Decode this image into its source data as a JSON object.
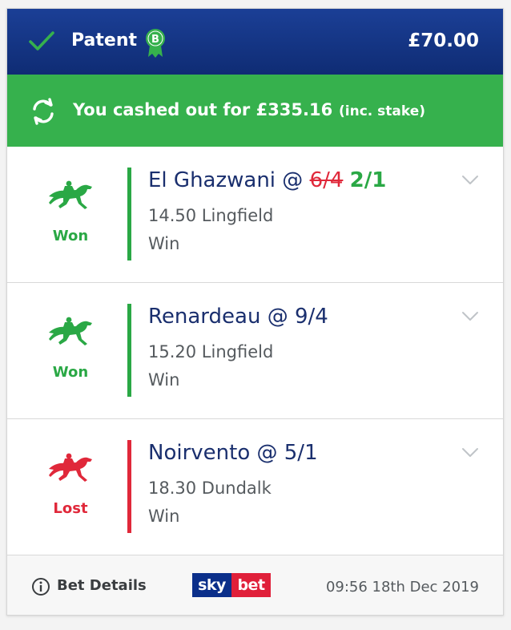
{
  "header": {
    "bet_type": "Patent",
    "stake": "£70.00",
    "badge_letter": "B",
    "colors": {
      "bg": "#143785",
      "text": "#ffffff",
      "check": "#36b14d"
    }
  },
  "cashout": {
    "message": "You cashed out for £335.16",
    "note": "(inc. stake)",
    "color": "#36b14d"
  },
  "selections": [
    {
      "horse": "El Ghazwani",
      "at": "@",
      "old_odds": "6/4",
      "odds": "2/1",
      "race": "14.50 Lingfield",
      "market": "Win",
      "result": "Won",
      "status_color": "#2aa845",
      "icon": "racehorse-icon"
    },
    {
      "horse": "Renardeau",
      "at": "@",
      "odds": "9/4",
      "race": "15.20 Lingfield",
      "market": "Win",
      "result": "Won",
      "status_color": "#2aa845",
      "icon": "racehorse-icon"
    },
    {
      "horse": "Noirvento",
      "at": "@",
      "odds": "5/1",
      "race": "18.30 Dundalk",
      "market": "Win",
      "result": "Lost",
      "status_color": "#e0283a",
      "icon": "racehorse-icon"
    }
  ],
  "footer": {
    "details_label": "Bet Details",
    "logo_left": "sky",
    "logo_right": "bet",
    "timestamp": "09:56 18th Dec 2019"
  }
}
